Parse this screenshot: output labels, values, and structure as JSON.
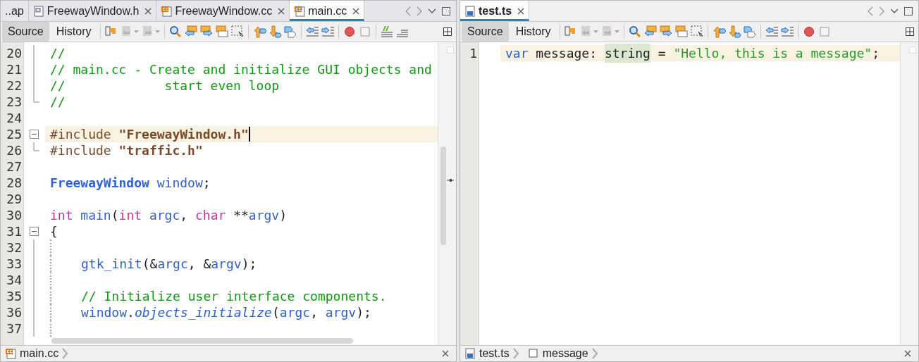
{
  "panes": [
    {
      "focused": false,
      "tabs": [
        {
          "label": "..ap",
          "kind": "partial",
          "selected": false
        },
        {
          "label": "FreewayWindow.h",
          "kind": "header",
          "selected": false
        },
        {
          "label": "FreewayWindow.cc",
          "kind": "source",
          "selected": false
        },
        {
          "label": "main.cc",
          "kind": "source",
          "selected": true
        }
      ],
      "views": [
        {
          "label": "Source",
          "selected": true
        },
        {
          "label": "History",
          "selected": false
        }
      ],
      "tool_groups": [
        [
          {
            "kind": "cursor",
            "disabled": false,
            "dropdown": false
          },
          {
            "kind": "back",
            "disabled": true,
            "dropdown": true
          },
          {
            "kind": "forward",
            "disabled": true,
            "dropdown": true
          }
        ],
        [
          {
            "kind": "search",
            "disabled": false,
            "dropdown": false
          },
          {
            "kind": "left",
            "disabled": false,
            "dropdown": false
          },
          {
            "kind": "right",
            "disabled": false,
            "dropdown": false
          },
          {
            "kind": "frames",
            "disabled": false,
            "dropdown": false
          },
          {
            "kind": "marquee",
            "disabled": false,
            "dropdown": false
          }
        ],
        [
          {
            "kind": "up",
            "disabled": false,
            "dropdown": false
          },
          {
            "kind": "down",
            "disabled": false,
            "dropdown": false
          },
          {
            "kind": "tag",
            "disabled": false,
            "dropdown": false
          }
        ],
        [
          {
            "kind": "outdent",
            "disabled": false,
            "dropdown": false
          },
          {
            "kind": "indent",
            "disabled": false,
            "dropdown": false
          }
        ],
        [
          {
            "kind": "record",
            "disabled": false,
            "dropdown": false
          },
          {
            "kind": "stop",
            "disabled": false,
            "dropdown": false
          }
        ],
        [
          {
            "kind": "comment",
            "disabled": false,
            "dropdown": false
          },
          {
            "kind": "uncomment",
            "disabled": false,
            "dropdown": false
          }
        ]
      ],
      "lines": [
        {
          "number": "20",
          "kind": "body",
          "block": false,
          "current": false,
          "tokens": [
            {
              "t": "//",
              "kind": "comment"
            }
          ]
        },
        {
          "number": "21",
          "kind": "body",
          "block": false,
          "current": false,
          "tokens": [
            {
              "t": "// main.cc - Create and initialize GUI objects and",
              "kind": "comment"
            }
          ]
        },
        {
          "number": "22",
          "kind": "body",
          "block": false,
          "current": false,
          "tokens": [
            {
              "t": "//             start even loop",
              "kind": "comment"
            }
          ]
        },
        {
          "number": "23",
          "kind": "end",
          "block": false,
          "current": false,
          "tokens": [
            {
              "t": "//",
              "kind": "comment"
            }
          ]
        },
        {
          "number": "24",
          "kind": "plain",
          "block": false,
          "current": false
        },
        {
          "number": "25",
          "kind": "start",
          "block": false,
          "current": true,
          "tokens": [
            {
              "t": "#include ",
              "kind": "directive"
            },
            {
              "t": "\"FreewayWindow.h\"",
              "kind": "include"
            }
          ]
        },
        {
          "number": "26",
          "kind": "end",
          "block": false,
          "current": false,
          "tokens": [
            {
              "t": "#include ",
              "kind": "directive"
            },
            {
              "t": "\"traffic.h\"",
              "kind": "include"
            }
          ]
        },
        {
          "number": "27",
          "kind": "plain",
          "block": false,
          "current": false
        },
        {
          "number": "28",
          "kind": "plain",
          "block": false,
          "current": false,
          "tokens": [
            {
              "t": "FreewayWindow ",
              "kind": "type"
            },
            {
              "t": "window",
              "kind": "var"
            },
            {
              "t": ";",
              "kind": "plain"
            }
          ]
        },
        {
          "number": "29",
          "kind": "plain",
          "block": false,
          "current": false
        },
        {
          "number": "30",
          "kind": "plain",
          "block": false,
          "current": false,
          "tokens": [
            {
              "t": "int ",
              "kind": "keyword"
            },
            {
              "t": "main",
              "kind": "var"
            },
            {
              "t": "(",
              "kind": "plain"
            },
            {
              "t": "int ",
              "kind": "keyword"
            },
            {
              "t": "argc",
              "kind": "var"
            },
            {
              "t": ", ",
              "kind": "plain"
            },
            {
              "t": "char",
              "kind": "keyword"
            },
            {
              "t": " **",
              "kind": "plain"
            },
            {
              "t": "argv",
              "kind": "var"
            },
            {
              "t": ")",
              "kind": "plain"
            }
          ]
        },
        {
          "number": "31",
          "kind": "start",
          "block": false,
          "current": false,
          "tokens": [
            {
              "t": "{",
              "kind": "plain"
            }
          ]
        },
        {
          "number": "32",
          "kind": "body",
          "block": true,
          "current": false
        },
        {
          "number": "33",
          "kind": "body",
          "block": true,
          "current": false,
          "tokens": [
            {
              "t": "gtk_init",
              "kind": "var"
            },
            {
              "t": "(&",
              "kind": "plain"
            },
            {
              "t": "argc",
              "kind": "var"
            },
            {
              "t": ", &",
              "kind": "plain"
            },
            {
              "t": "argv",
              "kind": "var"
            },
            {
              "t": ");",
              "kind": "plain"
            }
          ]
        },
        {
          "number": "34",
          "kind": "body",
          "block": true,
          "current": false
        },
        {
          "number": "35",
          "kind": "body",
          "block": true,
          "current": false,
          "tokens": [
            {
              "t": "// Initialize user interface components.",
              "kind": "comment"
            }
          ]
        },
        {
          "number": "36",
          "kind": "body",
          "block": true,
          "current": false,
          "tokens": [
            {
              "t": "window",
              "kind": "var"
            },
            {
              "t": ".",
              "kind": "plain"
            },
            {
              "t": "objects_initialize",
              "kind": "method"
            },
            {
              "t": "(",
              "kind": "plain"
            },
            {
              "t": "argc",
              "kind": "var"
            },
            {
              "t": ", ",
              "kind": "plain"
            },
            {
              "t": "argv",
              "kind": "var"
            },
            {
              "t": ");",
              "kind": "plain"
            }
          ]
        },
        {
          "number": "37",
          "kind": "body",
          "block": true,
          "current": false
        }
      ],
      "breadcrumbs": [
        {
          "label": "main.cc",
          "kind": "source"
        }
      ]
    },
    {
      "focused": true,
      "tabs": [
        {
          "label": "test.ts",
          "kind": "typescript",
          "selected": true
        }
      ],
      "views": [
        {
          "label": "Source",
          "selected": true
        },
        {
          "label": "History",
          "selected": false
        }
      ],
      "tool_groups": [
        [
          {
            "kind": "cursor",
            "disabled": false,
            "dropdown": false
          },
          {
            "kind": "back",
            "disabled": true,
            "dropdown": true
          },
          {
            "kind": "forward",
            "disabled": true,
            "dropdown": true
          }
        ],
        [
          {
            "kind": "search",
            "disabled": false,
            "dropdown": false
          },
          {
            "kind": "left",
            "disabled": false,
            "dropdown": false
          },
          {
            "kind": "right",
            "disabled": false,
            "dropdown": false
          },
          {
            "kind": "frames",
            "disabled": false,
            "dropdown": false
          },
          {
            "kind": "marquee",
            "disabled": false,
            "dropdown": false
          }
        ],
        [
          {
            "kind": "up",
            "disabled": false,
            "dropdown": false
          },
          {
            "kind": "down",
            "disabled": false,
            "dropdown": false
          },
          {
            "kind": "tag",
            "disabled": false,
            "dropdown": false
          }
        ],
        [
          {
            "kind": "outdent",
            "disabled": false,
            "dropdown": false
          },
          {
            "kind": "indent",
            "disabled": false,
            "dropdown": false
          }
        ],
        [
          {
            "kind": "record",
            "disabled": false,
            "dropdown": false
          },
          {
            "kind": "stop",
            "disabled": false,
            "dropdown": false
          }
        ]
      ],
      "lines": [
        {
          "number": "1",
          "kind": "plain",
          "block": false,
          "current": true,
          "tokens": [
            {
              "t": "var",
              "kind": "tskeyword"
            },
            {
              "t": " message: ",
              "kind": "plain"
            },
            {
              "t": "string",
              "kind": "marked"
            },
            {
              "t": " = ",
              "kind": "plain"
            },
            {
              "t": "\"Hello, this is a message\"",
              "kind": "string"
            },
            {
              "t": ";",
              "kind": "plain"
            }
          ]
        }
      ],
      "breadcrumbs": [
        {
          "label": "test.ts",
          "kind": "typescript"
        },
        {
          "label": "message",
          "kind": "variable"
        }
      ]
    }
  ]
}
